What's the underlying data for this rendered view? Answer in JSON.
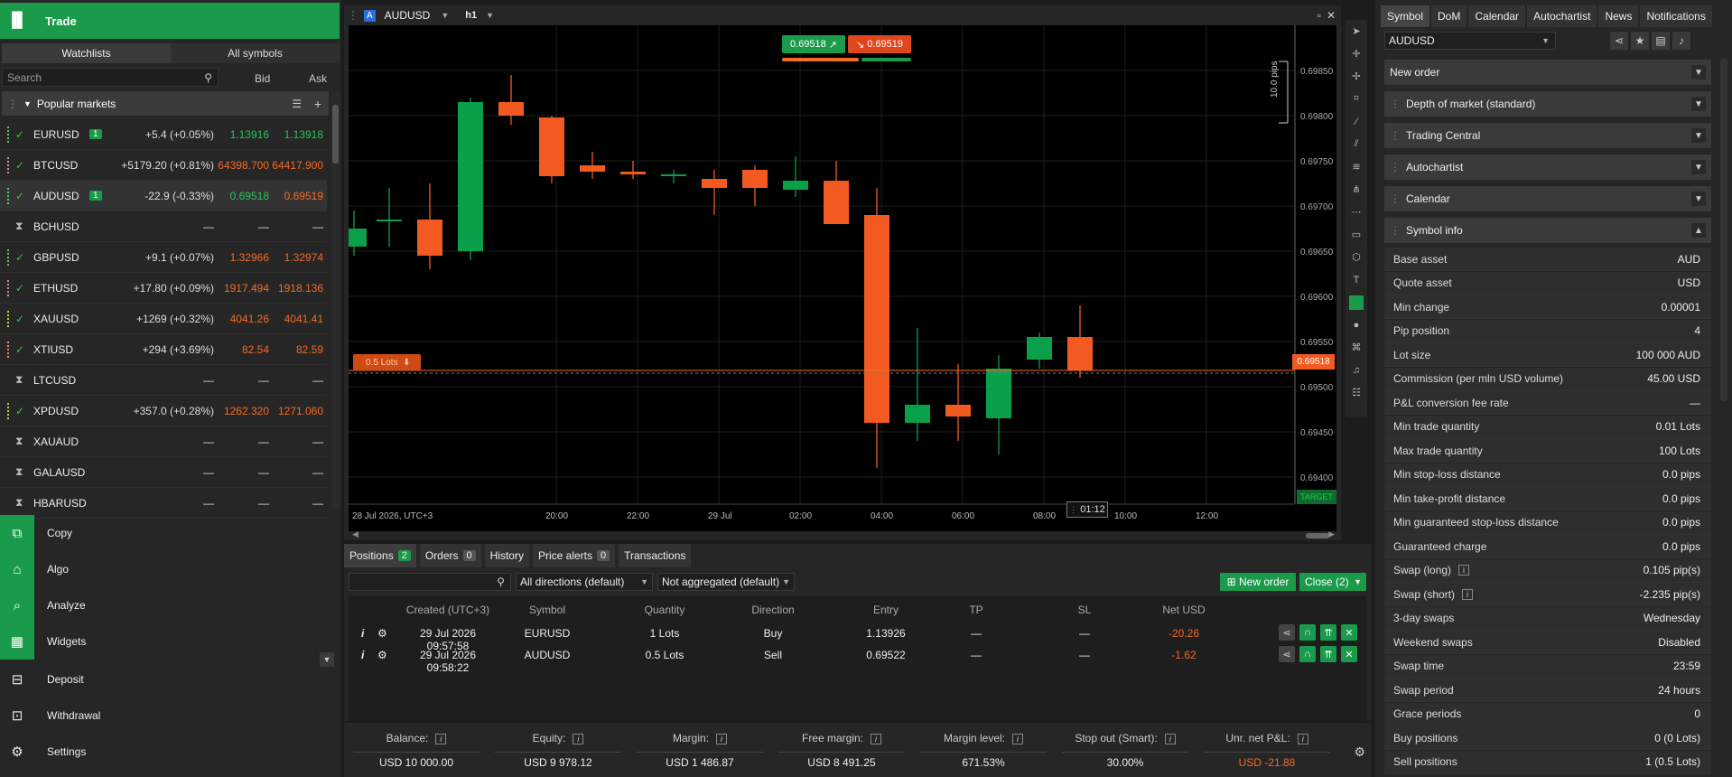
{
  "sidebar": {
    "trade_label": "Trade",
    "tabs": [
      "Watchlists",
      "All symbols"
    ],
    "search_placeholder": "Search",
    "col_bid": "Bid",
    "col_ask": "Ask",
    "group": "Popular markets",
    "rows": [
      {
        "sym": "EURUSD",
        "badge": "1",
        "chg": "+5.4 (+0.05%)",
        "bid": "1.13916",
        "ask": "1.13918",
        "status": "check"
      },
      {
        "sym": "BTCUSD",
        "badge": "",
        "chg": "+5179.20 (+0.81%)",
        "bid": "64398.700",
        "ask": "64417.900",
        "status": "check"
      },
      {
        "sym": "AUDUSD",
        "badge": "1",
        "chg": "-22.9 (-0.33%)",
        "bid": "0.69518",
        "ask": "0.69519",
        "status": "check"
      },
      {
        "sym": "BCHUSD",
        "badge": "",
        "chg": "—",
        "bid": "—",
        "ask": "—",
        "status": "hourglass"
      },
      {
        "sym": "GBPUSD",
        "badge": "",
        "chg": "+9.1 (+0.07%)",
        "bid": "1.32966",
        "ask": "1.32974",
        "status": "check"
      },
      {
        "sym": "ETHUSD",
        "badge": "",
        "chg": "+17.80 (+0.09%)",
        "bid": "1917.494",
        "ask": "1918.136",
        "status": "check"
      },
      {
        "sym": "XAUUSD",
        "badge": "",
        "chg": "+1269 (+0.32%)",
        "bid": "4041.26",
        "ask": "4041.41",
        "status": "check"
      },
      {
        "sym": "XTIUSD",
        "badge": "",
        "chg": "+294 (+3.69%)",
        "bid": "82.54",
        "ask": "82.59",
        "status": "check"
      },
      {
        "sym": "LTCUSD",
        "badge": "",
        "chg": "—",
        "bid": "—",
        "ask": "—",
        "status": "hourglass"
      },
      {
        "sym": "XPDUSD",
        "badge": "",
        "chg": "+357.0 (+0.28%)",
        "bid": "1262.320",
        "ask": "1271.060",
        "status": "check"
      },
      {
        "sym": "XAUAUD",
        "badge": "",
        "chg": "—",
        "bid": "—",
        "ask": "—",
        "status": "hourglass"
      },
      {
        "sym": "GALAUSD",
        "badge": "",
        "chg": "—",
        "bid": "—",
        "ask": "—",
        "status": "hourglass"
      },
      {
        "sym": "HBARUSD",
        "badge": "",
        "chg": "—",
        "bid": "—",
        "ask": "—",
        "status": "hourglass"
      }
    ],
    "menu": [
      "Copy",
      "Algo",
      "Analyze",
      "Widgets",
      "Deposit",
      "Withdrawal",
      "Settings"
    ]
  },
  "chart": {
    "symbol": "AUDUSD",
    "timeframe": "h1",
    "sell": "0.69518",
    "buy": "0.69519",
    "pips": "10.0 pips",
    "lots_label": "0.5 Lots",
    "price_tag": "0.69518",
    "target": "TARGET",
    "countdown": "01:12",
    "yticks": [
      "0.69850",
      "0.69800",
      "0.69750",
      "0.69700",
      "0.69650",
      "0.69600",
      "0.69550",
      "0.69500",
      "0.69450",
      "0.69400"
    ],
    "xticks": [
      "28 Jul 2026, UTC+3",
      "20:00",
      "22:00",
      "29 Jul",
      "02:00",
      "04:00",
      "06:00",
      "08:00",
      "10:00",
      "12:00"
    ]
  },
  "chart_data": {
    "type": "candlestick",
    "symbol": "AUDUSD",
    "timeframe": "h1",
    "ylim": [
      0.6937,
      0.699
    ],
    "candles": [
      {
        "o": 0.69655,
        "h": 0.69695,
        "l": 0.69645,
        "c": 0.69675
      },
      {
        "o": 0.69685,
        "h": 0.6972,
        "l": 0.69655,
        "c": 0.69685
      },
      {
        "o": 0.69685,
        "h": 0.69725,
        "l": 0.6963,
        "c": 0.69645
      },
      {
        "o": 0.6965,
        "h": 0.6982,
        "l": 0.6964,
        "c": 0.69815
      },
      {
        "o": 0.69815,
        "h": 0.69845,
        "l": 0.6979,
        "c": 0.698
      },
      {
        "o": 0.69798,
        "h": 0.698,
        "l": 0.69725,
        "c": 0.69733
      },
      {
        "o": 0.69745,
        "h": 0.6976,
        "l": 0.6973,
        "c": 0.69738
      },
      {
        "o": 0.69738,
        "h": 0.6975,
        "l": 0.6973,
        "c": 0.69735
      },
      {
        "o": 0.69733,
        "h": 0.6974,
        "l": 0.69725,
        "c": 0.69735
      },
      {
        "o": 0.6973,
        "h": 0.6974,
        "l": 0.6969,
        "c": 0.6972
      },
      {
        "o": 0.6974,
        "h": 0.69745,
        "l": 0.697,
        "c": 0.6972
      },
      {
        "o": 0.69718,
        "h": 0.69755,
        "l": 0.6971,
        "c": 0.69728
      },
      {
        "o": 0.69728,
        "h": 0.6975,
        "l": 0.6968,
        "c": 0.6968
      },
      {
        "o": 0.6969,
        "h": 0.6972,
        "l": 0.6941,
        "c": 0.6946
      },
      {
        "o": 0.6946,
        "h": 0.69565,
        "l": 0.6944,
        "c": 0.6948
      },
      {
        "o": 0.6948,
        "h": 0.69525,
        "l": 0.6944,
        "c": 0.69467
      },
      {
        "o": 0.69465,
        "h": 0.69535,
        "l": 0.69425,
        "c": 0.6952
      },
      {
        "o": 0.6953,
        "h": 0.6956,
        "l": 0.6952,
        "c": 0.69555
      },
      {
        "o": 0.69555,
        "h": 0.6959,
        "l": 0.6951,
        "c": 0.69518
      }
    ],
    "current_price": 0.69518
  },
  "right": {
    "tabs": [
      "Symbol",
      "DoM",
      "Calendar",
      "Autochartist",
      "News",
      "Notifications"
    ],
    "symbol": "AUDUSD",
    "sections": [
      "New order",
      "Depth of market (standard)",
      "Trading Central",
      "Autochartist",
      "Calendar",
      "Symbol info"
    ],
    "info": [
      [
        "Base asset",
        "AUD"
      ],
      [
        "Quote asset",
        "USD"
      ],
      [
        "Min change",
        "0.00001"
      ],
      [
        "Pip position",
        "4"
      ],
      [
        "Lot size",
        "100 000 AUD"
      ],
      [
        "Commission (per mln USD volume)",
        "45.00 USD"
      ],
      [
        "P&L conversion fee rate",
        "—"
      ],
      [
        "Min trade quantity",
        "0.01 Lots"
      ],
      [
        "Max trade quantity",
        "100 Lots"
      ],
      [
        "Min stop-loss distance",
        "0.0 pips"
      ],
      [
        "Min take-profit distance",
        "0.0 pips"
      ],
      [
        "Min guaranteed stop-loss distance",
        "0.0 pips"
      ],
      [
        "Guaranteed charge",
        "0.0 pips"
      ],
      [
        "Swap (long)",
        "0.105 pip(s)"
      ],
      [
        "Swap (short)",
        "-2.235 pip(s)"
      ],
      [
        "3-day swaps",
        "Wednesday"
      ],
      [
        "Weekend swaps",
        "Disabled"
      ],
      [
        "Swap time",
        "23:59"
      ],
      [
        "Swap period",
        "24 hours"
      ],
      [
        "Grace periods",
        "0"
      ],
      [
        "Buy positions",
        "0  (0 Lots)"
      ],
      [
        "Sell positions",
        "1  (0.5 Lots)"
      ]
    ]
  },
  "bottom": {
    "tabs": [
      {
        "label": "Positions",
        "count": "2"
      },
      {
        "label": "Orders",
        "count": "0"
      },
      {
        "label": "History",
        "count": ""
      },
      {
        "label": "Price alerts",
        "count": "0"
      },
      {
        "label": "Transactions",
        "count": ""
      }
    ],
    "filter_dir": "All directions (default)",
    "filter_agg": "Not aggregated (default)",
    "new_order": "New order",
    "close": "Close (2)",
    "headers": [
      "Created (UTC+3)",
      "Symbol",
      "Quantity",
      "Direction",
      "Entry",
      "TP",
      "SL",
      "Net USD"
    ],
    "rows": [
      {
        "created": "29 Jul 2026 09:57:58",
        "symbol": "EURUSD",
        "qty": "1 Lots",
        "dir": "Buy",
        "entry": "1.13926",
        "tp": "—",
        "sl": "—",
        "net": "-20.26"
      },
      {
        "created": "29 Jul 2026 09:58:22",
        "symbol": "AUDUSD",
        "qty": "0.5 Lots",
        "dir": "Sell",
        "entry": "0.69522",
        "tp": "—",
        "sl": "—",
        "net": "-1.62"
      }
    ]
  },
  "account": [
    {
      "label": "Balance:",
      "value": "USD 10 000.00"
    },
    {
      "label": "Equity:",
      "value": "USD 9 978.12"
    },
    {
      "label": "Margin:",
      "value": "USD 1 486.87"
    },
    {
      "label": "Free margin:",
      "value": "USD 8 491.25"
    },
    {
      "label": "Margin level:",
      "value": "671.53%"
    },
    {
      "label": "Stop out (Smart):",
      "value": "30.00%"
    },
    {
      "label": "Unr. net P&L:",
      "value": "USD -21.88"
    }
  ],
  "colors": {
    "green": "#1a9b4b",
    "orange": "#f56a25",
    "bull": "#0aa04a",
    "bear": "#f25a22"
  }
}
